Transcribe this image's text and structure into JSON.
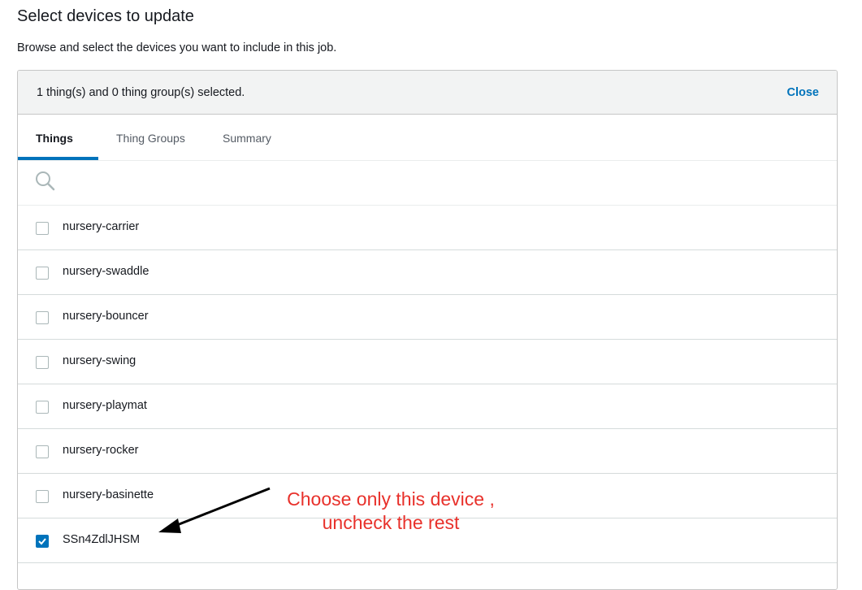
{
  "page": {
    "title": "Select devices to update",
    "subtitle": "Browse and select the devices you want to include in this job."
  },
  "panel": {
    "summary": "1 thing(s) and 0 thing group(s) selected.",
    "close_label": "Close"
  },
  "tabs": [
    {
      "label": "Things",
      "active": true
    },
    {
      "label": "Thing Groups",
      "active": false
    },
    {
      "label": "Summary",
      "active": false
    }
  ],
  "search": {
    "icon": "search-icon"
  },
  "things": [
    {
      "name": "nursery-carrier",
      "checked": false
    },
    {
      "name": "nursery-swaddle",
      "checked": false
    },
    {
      "name": "nursery-bouncer",
      "checked": false
    },
    {
      "name": "nursery-swing",
      "checked": false
    },
    {
      "name": "nursery-playmat",
      "checked": false
    },
    {
      "name": "nursery-rocker",
      "checked": false
    },
    {
      "name": "nursery-basinette",
      "checked": false
    },
    {
      "name": "SSn4ZdlJHSM",
      "checked": true
    }
  ],
  "annotation": {
    "line1": "Choose only this device ,",
    "line2": "uncheck the rest",
    "color": "#e8312b"
  },
  "colors": {
    "accent": "#0073bb"
  }
}
